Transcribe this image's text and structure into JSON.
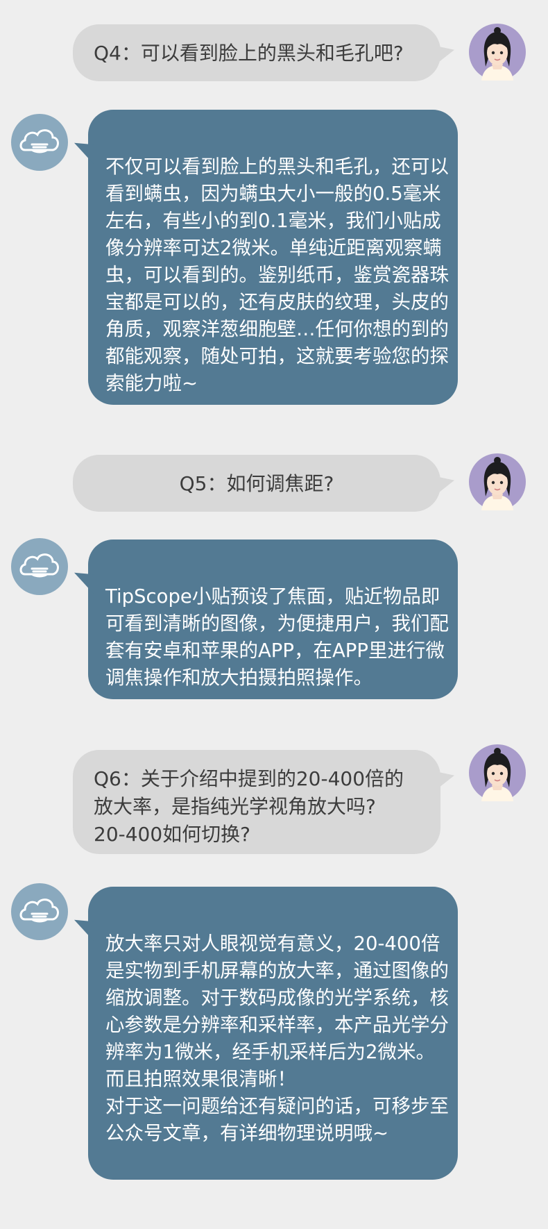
{
  "colors": {
    "background": "#eeeeee",
    "question_bubble": "#d8d8d8",
    "question_text": "#3c3c3c",
    "answer_bubble": "#537a93",
    "answer_text": "#ffffff",
    "avatar_bg": "#a99ccb",
    "bot_icon_bg": "#8aa9be"
  },
  "icons": {
    "user": "user-avatar-icon",
    "bot": "cloud-bot-icon"
  },
  "qa": [
    {
      "question": "Q4：可以看到脸上的黑头和毛孔吧?",
      "answer": "不仅可以看到脸上的黑头和毛孔，还可以看到螨虫，因为螨虫大小一般的0.5毫米左右，有些小的到0.1毫米，我们小贴成像分辨率可达2微米。单纯近距离观察螨虫，可以看到的。鉴别纸币，鉴赏瓷器珠宝都是可以的，还有皮肤的纹理，头皮的角质，观察洋葱细胞壁…任何你想的到的都能观察，随处可拍，这就要考验您的探索能力啦~"
    },
    {
      "question": "Q5：如何调焦距?",
      "answer": "TipScope小贴预设了焦面，贴近物品即可看到清晰的图像，为便捷用户，我们配套有安卓和苹果的APP，在APP里进行微调焦操作和放大拍摄拍照操作。"
    },
    {
      "question": "Q6：关于介绍中提到的20-400倍的放大率，是指纯光学视角放大吗?\n20-400如何切换?",
      "answer": "放大率只对人眼视觉有意义，20-400倍是实物到手机屏幕的放大率，通过图像的缩放调整。对于数码成像的光学系统，核心参数是分辨率和采样率，本产品光学分辨率为1微米，经手机采样后为2微米。而且拍照效果很清晰！\n对于这一问题给还有疑问的话，可移步至公众号文章，有详细物理说明哦~"
    }
  ]
}
